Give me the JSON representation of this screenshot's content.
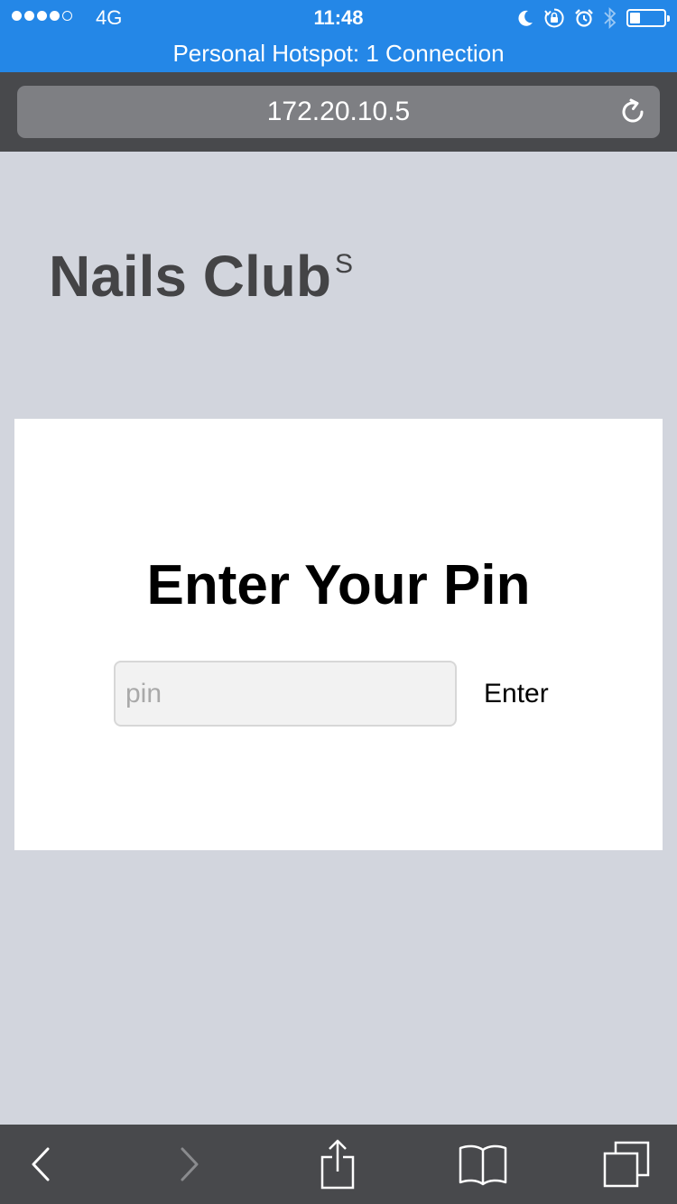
{
  "status_bar": {
    "carrier": "4G",
    "time": "11:48",
    "hotspot_banner": "Personal Hotspot: 1 Connection",
    "battery_level": 0.3,
    "icons": [
      "moon-icon",
      "orientation-lock-icon",
      "alarm-icon",
      "bluetooth-icon",
      "battery-icon"
    ],
    "colors": {
      "banner": "#2487e7"
    }
  },
  "browser": {
    "url": "172.20.10.5",
    "toolbar": [
      "back-icon",
      "forward-icon",
      "share-icon",
      "bookmarks-icon",
      "tabs-icon"
    ]
  },
  "page": {
    "brand": "Nails Club",
    "brand_superscript": "S",
    "pin_title": "Enter Your Pin",
    "pin_placeholder": "pin",
    "pin_value": "",
    "enter_label": "Enter"
  }
}
